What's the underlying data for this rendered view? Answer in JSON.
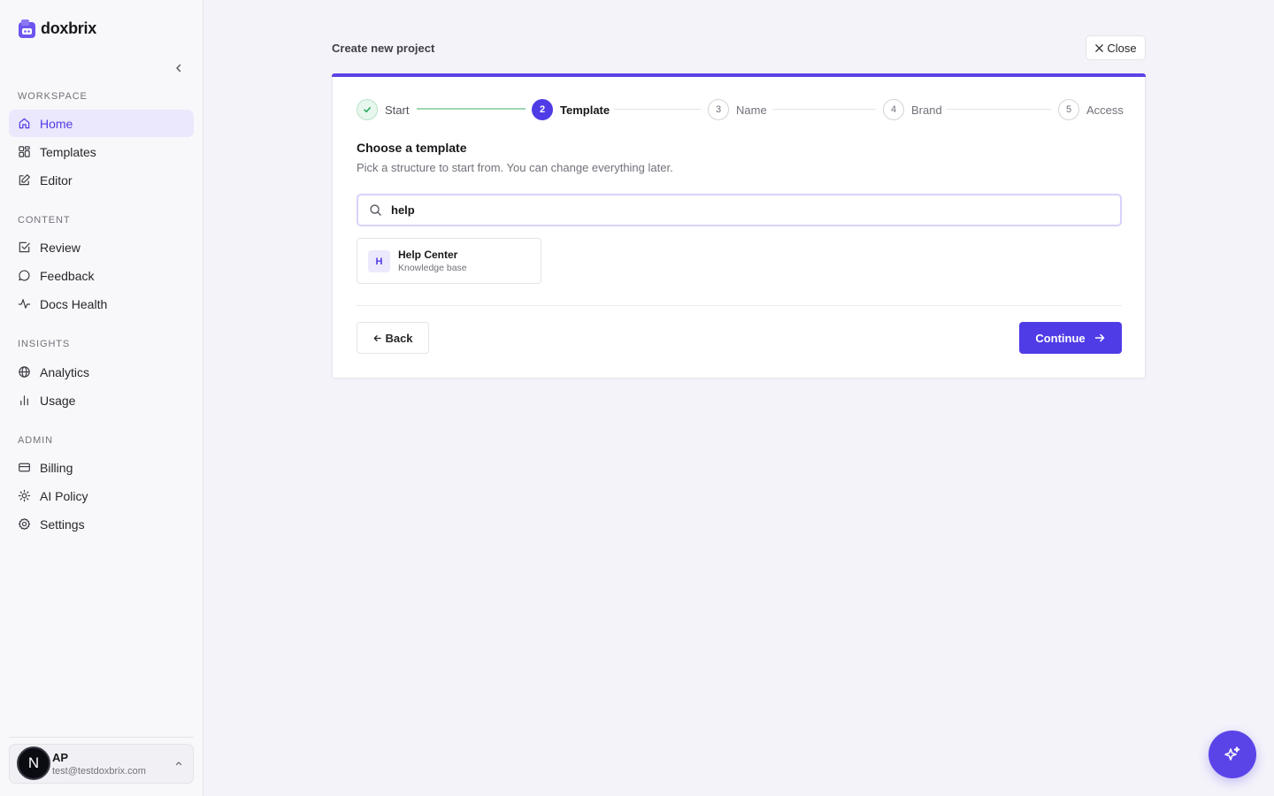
{
  "app": {
    "name": "doxbrix"
  },
  "sidebar": {
    "sections": [
      {
        "heading": "WORKSPACE",
        "items": [
          {
            "label": "Home",
            "icon": "home-icon",
            "active": true
          },
          {
            "label": "Templates",
            "icon": "grid-icon"
          },
          {
            "label": "Editor",
            "icon": "edit-icon"
          }
        ]
      },
      {
        "heading": "CONTENT",
        "items": [
          {
            "label": "Review",
            "icon": "check-square-icon"
          },
          {
            "label": "Feedback",
            "icon": "message-circle-icon"
          },
          {
            "label": "Docs Health",
            "icon": "activity-icon"
          }
        ]
      },
      {
        "heading": "INSIGHTS",
        "items": [
          {
            "label": "Analytics",
            "icon": "globe-icon"
          },
          {
            "label": "Usage",
            "icon": "bar-chart-icon"
          }
        ]
      },
      {
        "heading": "ADMIN",
        "items": [
          {
            "label": "Billing",
            "icon": "credit-card-icon"
          },
          {
            "label": "AI Policy",
            "icon": "sun-icon"
          },
          {
            "label": "Settings",
            "icon": "gear-icon"
          }
        ]
      }
    ],
    "user": {
      "avatar_letter": "N",
      "initials": "AP",
      "email": "test@testdoxbrix.com"
    }
  },
  "main": {
    "title": "Create new project",
    "close_label": "Close",
    "steps": [
      {
        "number": "1",
        "label": "Start",
        "state": "done"
      },
      {
        "number": "2",
        "label": "Template",
        "state": "current"
      },
      {
        "number": "3",
        "label": "Name",
        "state": "todo"
      },
      {
        "number": "4",
        "label": "Brand",
        "state": "todo"
      },
      {
        "number": "5",
        "label": "Access",
        "state": "todo"
      }
    ],
    "section_title": "Choose a template",
    "section_subtitle": "Pick a structure to start from. You can change everything later.",
    "search": {
      "value": "help",
      "placeholder": ""
    },
    "templates": [
      {
        "badge": "H",
        "name": "Help Center",
        "description": "Knowledge base"
      }
    ],
    "back_label": "Back",
    "continue_label": "Continue"
  },
  "colors": {
    "accent": "#4f3ce6",
    "success": "#22a559"
  }
}
